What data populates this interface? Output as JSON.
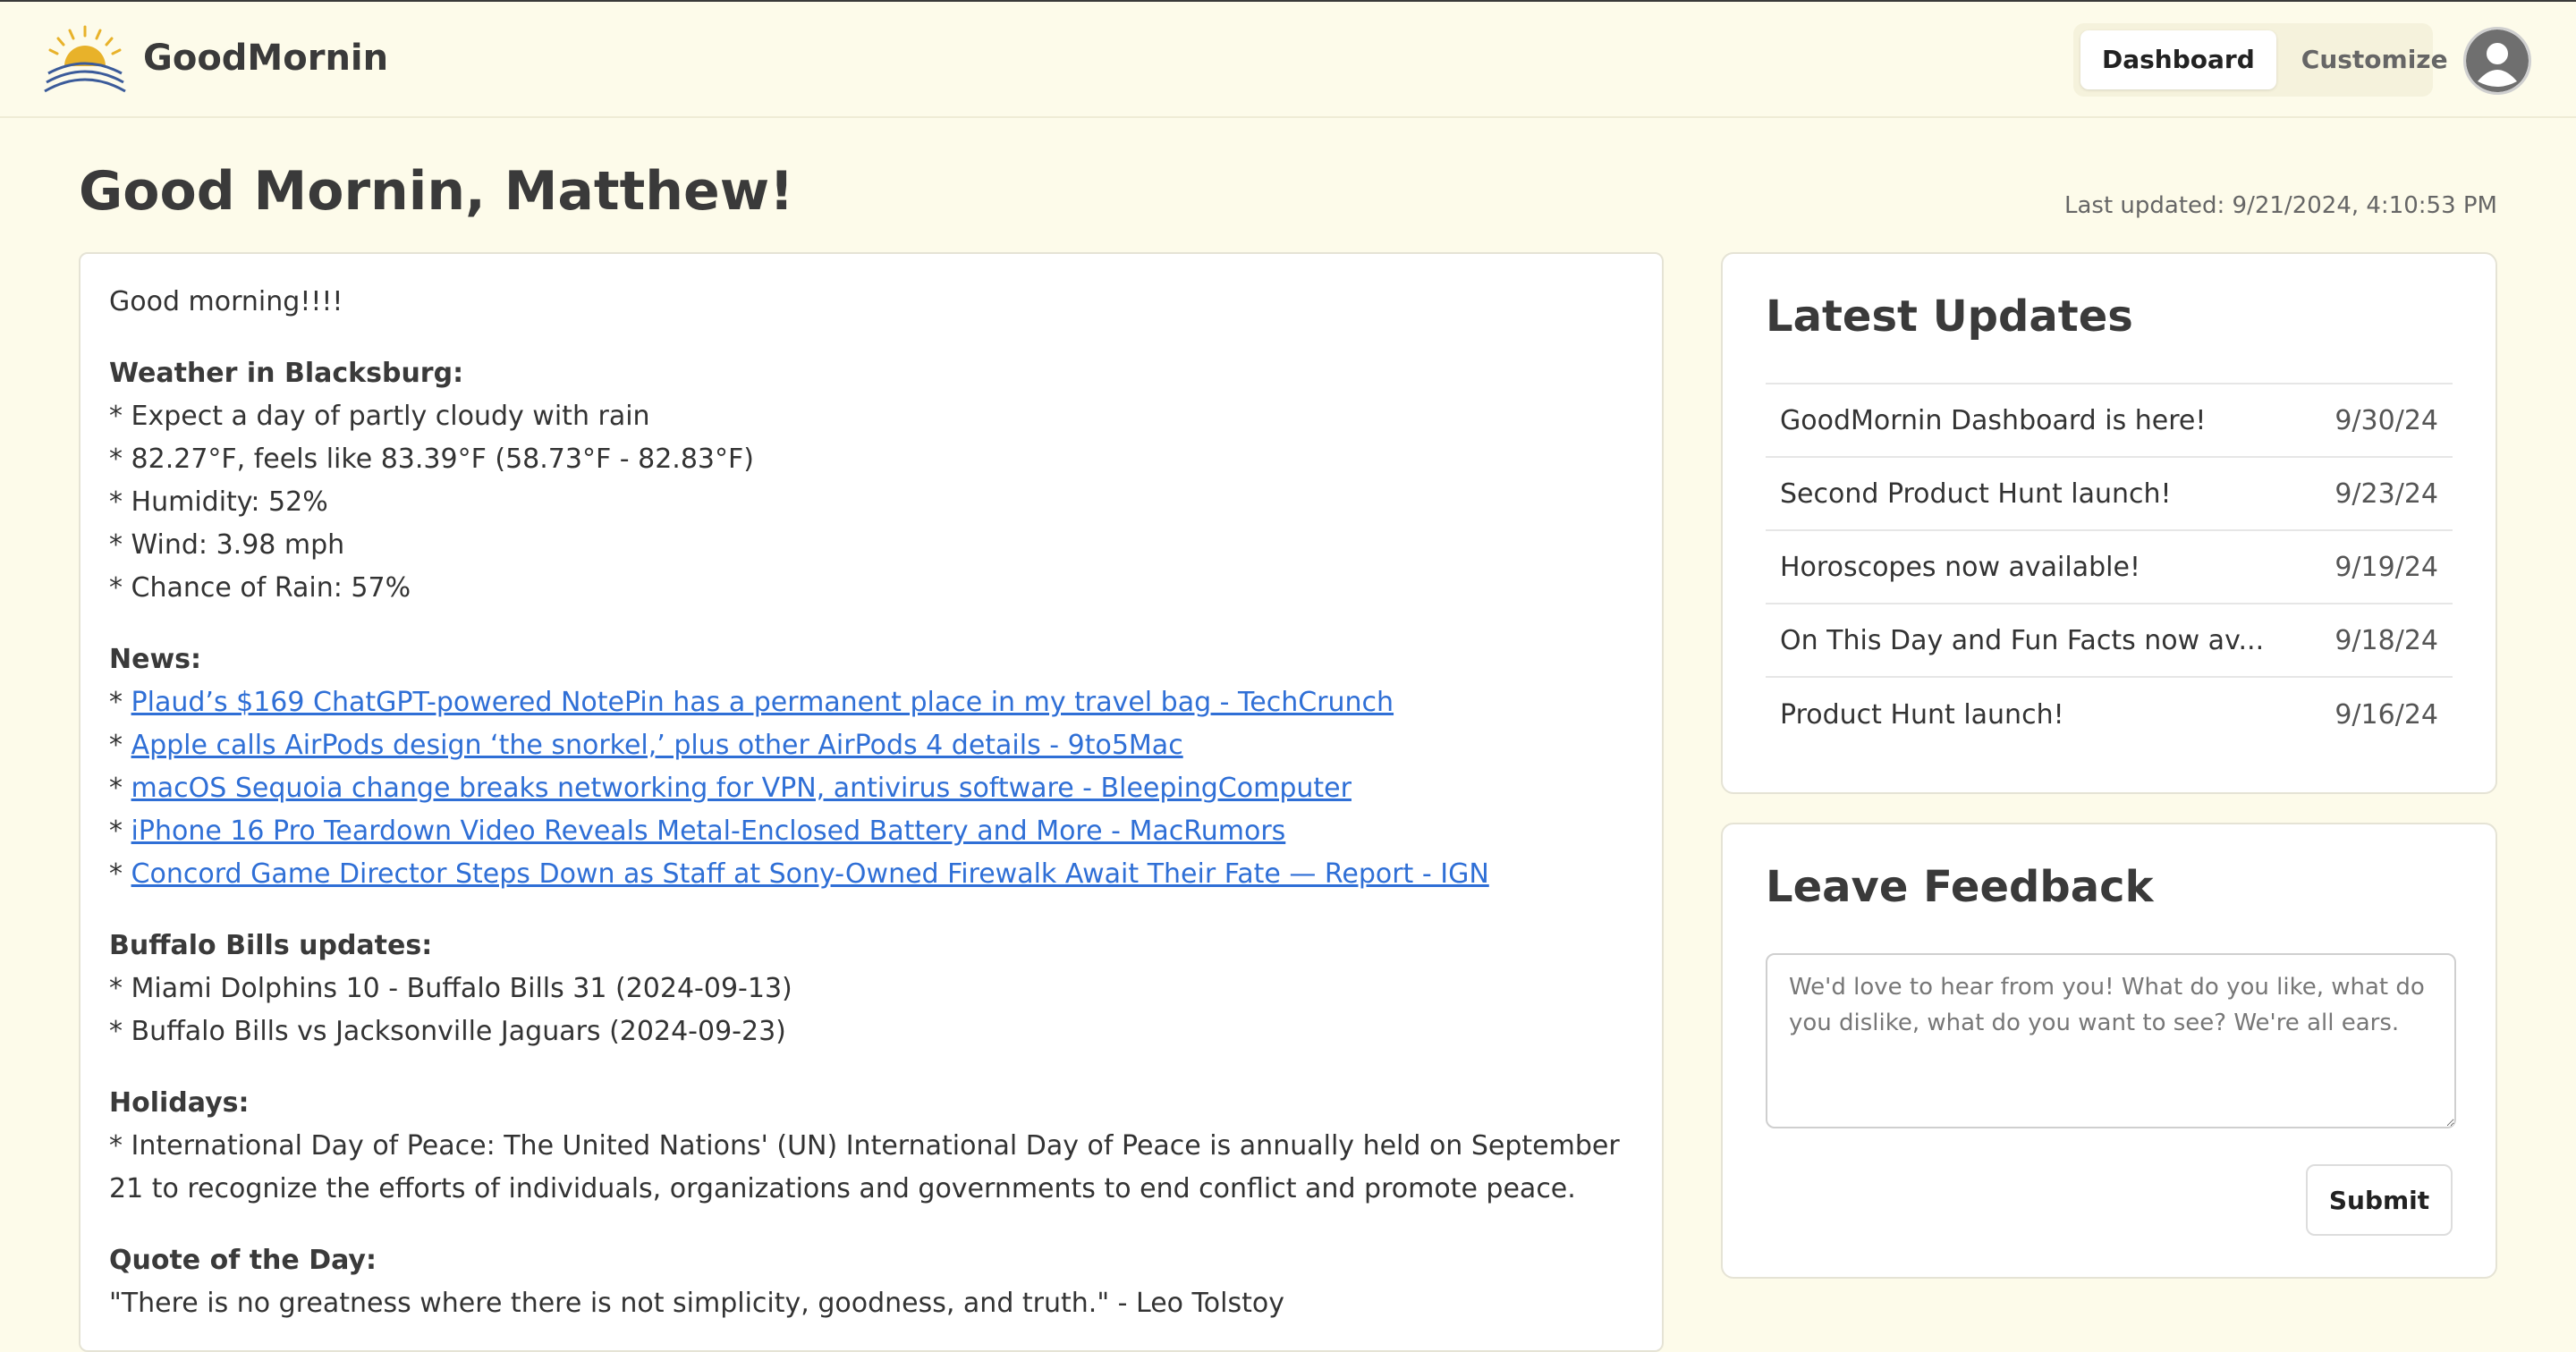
{
  "header": {
    "brand": "GoodMornin",
    "logo_icon": "sunrise-logo-icon",
    "tabs": [
      {
        "label": "Dashboard",
        "active": true
      },
      {
        "label": "Customize",
        "active": false
      }
    ],
    "avatar_icon": "user-avatar-icon"
  },
  "page": {
    "greeting": "Good Mornin, Matthew!",
    "last_updated": "Last updated: 9/21/2024, 4:10:53 PM"
  },
  "brief": {
    "intro": "Good morning!!!!",
    "weather": {
      "heading": "Weather in Blacksburg:",
      "lines": [
        "* Expect a day of partly cloudy with rain",
        "* 82.27°F, feels like 83.39°F (58.73°F - 82.83°F)",
        "* Humidity: 52%",
        "* Wind: 3.98 mph",
        "* Chance of Rain: 57%"
      ]
    },
    "news": {
      "heading": "News:",
      "bullet": "* ",
      "items": [
        "Plaud’s $169 ChatGPT-powered NotePin has a permanent place in my travel bag - TechCrunch",
        "Apple calls AirPods design ‘the snorkel,’ plus other AirPods 4 details - 9to5Mac",
        "macOS Sequoia change breaks networking for VPN, antivirus software - BleepingComputer",
        "iPhone 16 Pro Teardown Video Reveals Metal-Enclosed Battery and More - MacRumors",
        "Concord Game Director Steps Down as Staff at Sony-Owned Firewalk Await Their Fate — Report - IGN"
      ]
    },
    "bills": {
      "heading": "Buffalo Bills updates:",
      "lines": [
        "* Miami Dolphins 10 - Buffalo Bills 31 (2024-09-13)",
        "* Buffalo Bills vs Jacksonville Jaguars (2024-09-23)"
      ]
    },
    "holidays": {
      "heading": "Holidays:",
      "lines": [
        "* International Day of Peace: The United Nations' (UN) International Day of Peace is annually held on September 21 to recognize the efforts of individuals, organizations and governments to end conflict and promote peace."
      ]
    },
    "quote": {
      "heading": "Quote of the Day:",
      "text": "\"There is no greatness where there is not simplicity, goodness, and truth.\" - Leo Tolstoy"
    }
  },
  "updates": {
    "title": "Latest Updates",
    "items": [
      {
        "title": "GoodMornin Dashboard is here!",
        "date": "9/30/24"
      },
      {
        "title": "Second Product Hunt launch!",
        "date": "9/23/24"
      },
      {
        "title": "Horoscopes now available!",
        "date": "9/19/24"
      },
      {
        "title": "On This Day and Fun Facts now av...",
        "date": "9/18/24"
      },
      {
        "title": "Product Hunt launch!",
        "date": "9/16/24"
      }
    ]
  },
  "feedback": {
    "title": "Leave Feedback",
    "placeholder": "We'd love to hear from you! What do you like, what do you dislike, what do you want to see? We're all ears.",
    "value": "",
    "submit_label": "Submit"
  },
  "colors": {
    "background": "#fdfbea",
    "link": "#2f6fd6",
    "logo_sun": "#e8b22a",
    "logo_arc": "#3b5b9a"
  }
}
